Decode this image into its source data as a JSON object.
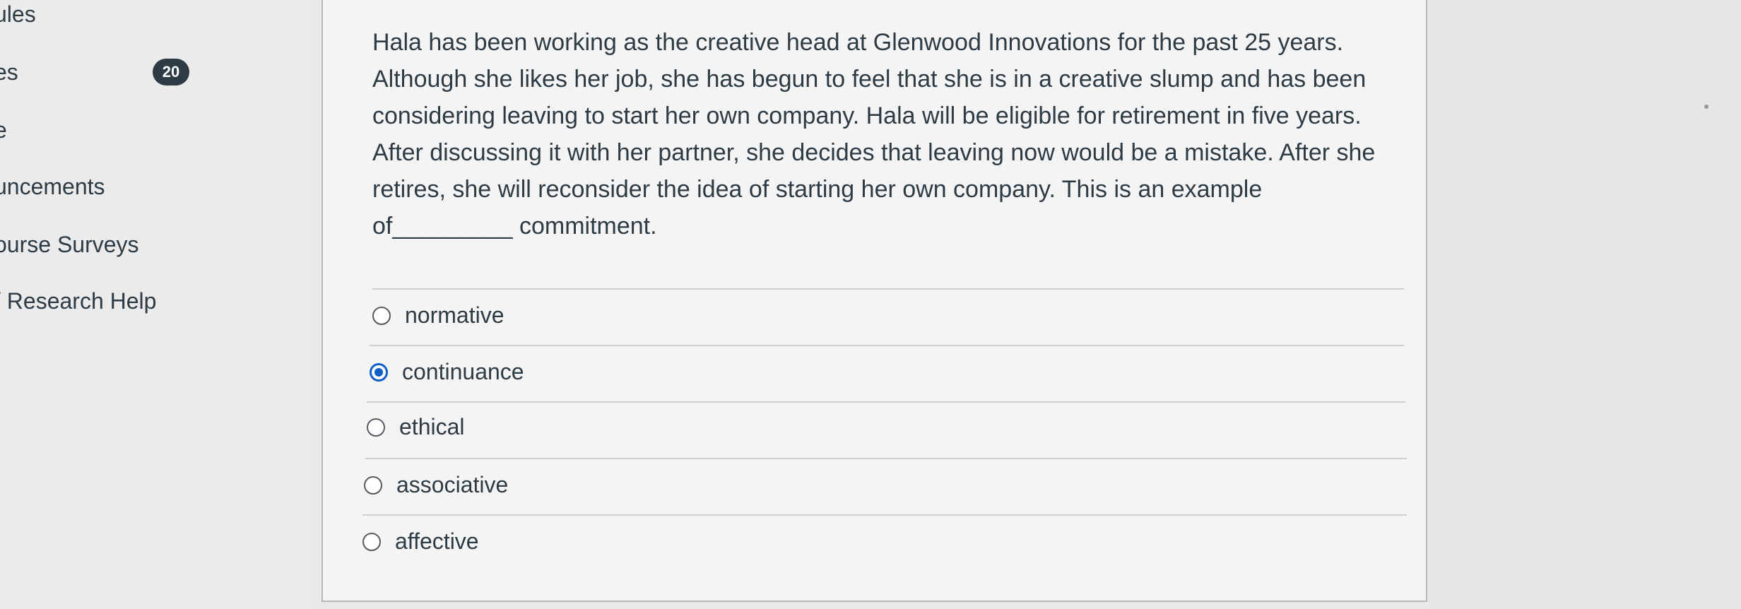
{
  "sidebar": {
    "items": [
      {
        "label": "ules"
      },
      {
        "label": "es",
        "badge": "20"
      },
      {
        "label": "e"
      },
      {
        "label": "uncements"
      },
      {
        "label": "ourse Surveys"
      },
      {
        "label": "/ Research Help"
      }
    ]
  },
  "question": {
    "text": "Hala has been working as the creative head at Glenwood Innovations for the past 25 years. Although she likes her job, she has begun to feel that she is in a creative slump and has been considering leaving to start her own company. Hala will be eligible for retirement in five years. After discussing it with her partner, she decides that leaving now would be a mistake. After she retires, she will reconsider the idea of starting her own company. This is an example of_________ commitment.",
    "answers": [
      {
        "label": "normative",
        "selected": false
      },
      {
        "label": "continuance",
        "selected": true
      },
      {
        "label": "ethical",
        "selected": false
      },
      {
        "label": "associative",
        "selected": false
      },
      {
        "label": "affective",
        "selected": false
      }
    ]
  },
  "colors": {
    "text": "#2d3b45",
    "selected_radio": "#0b5fc7",
    "badge_bg": "#2d3b45"
  }
}
